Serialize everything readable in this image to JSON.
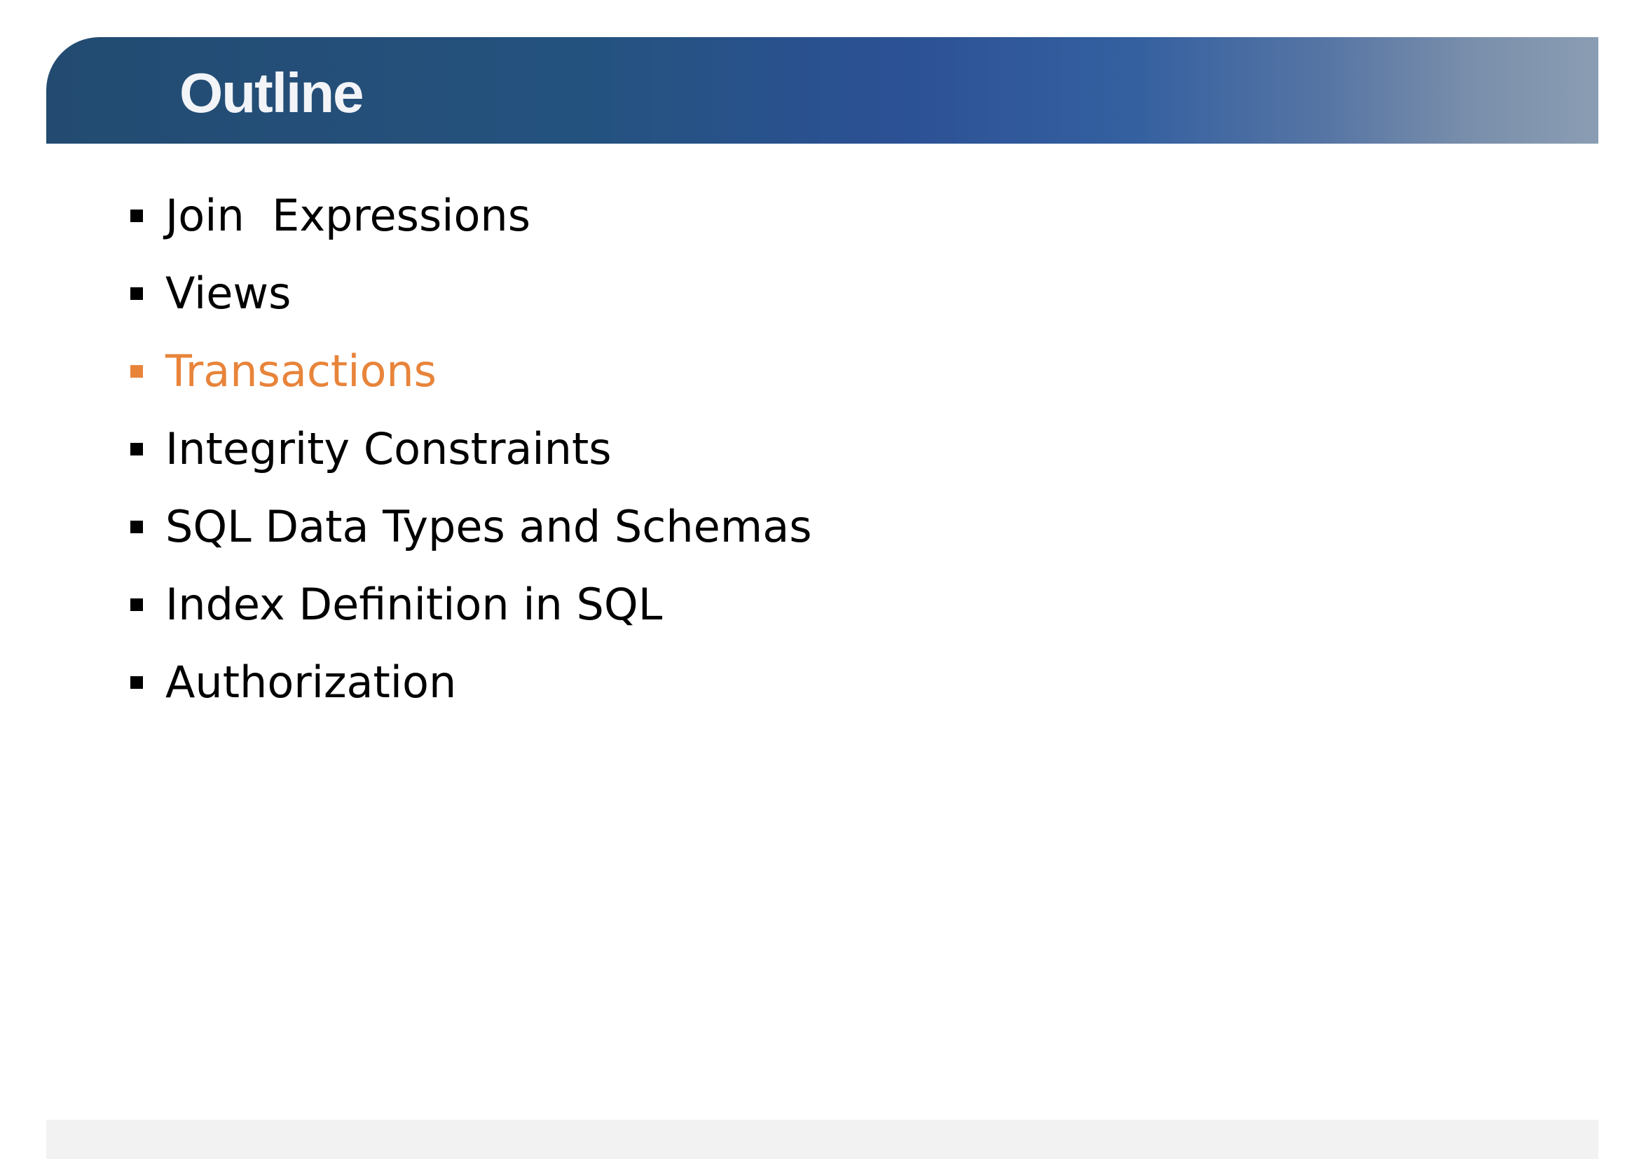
{
  "slide": {
    "title": "Outline",
    "items": [
      {
        "label": "Join  Expressions",
        "active": false
      },
      {
        "label": "Views",
        "active": false
      },
      {
        "label": "Transactions",
        "active": true
      },
      {
        "label": "Integrity Constraints",
        "active": false
      },
      {
        "label": "SQL Data Types and Schemas",
        "active": false
      },
      {
        "label": "Index Definition in SQL",
        "active": false
      },
      {
        "label": "Authorization",
        "active": false
      }
    ]
  },
  "colors": {
    "header_gradient_start": "#234b71",
    "header_gradient_end": "#8a9db3",
    "title_text": "#f2f4f7",
    "item_text": "#000000",
    "active_item": "#e8843a",
    "footer_bar": "#f2f2f2"
  },
  "icons": {
    "bullet": "square-bullet-icon"
  }
}
